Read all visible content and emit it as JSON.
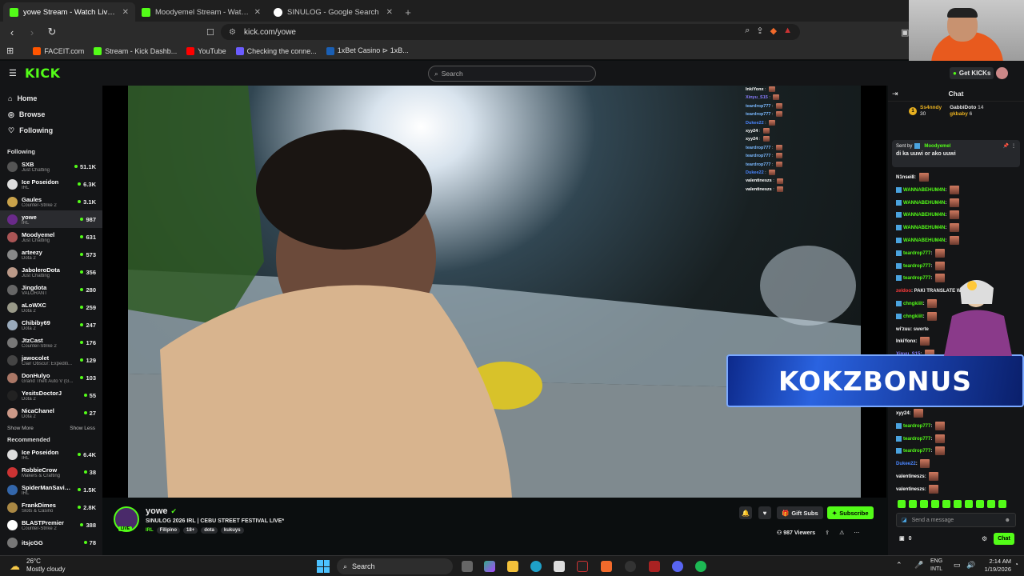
{
  "browser": {
    "tabs": [
      {
        "title": "yowe Stream - Watch Live on Kick",
        "icon": "K",
        "active": true
      },
      {
        "title": "Moodyemel Stream - Watch Live on Kick",
        "icon": "K",
        "active": false
      },
      {
        "title": "SINULOG - Google Search",
        "icon": "G",
        "active": false
      }
    ],
    "url": "kick.com/yowe",
    "bookmarks": [
      "FACEIT.com",
      "Stream - Kick Dashb...",
      "YouTube",
      "Checking the conne...",
      "1xBet Casino ⊳ 1xB..."
    ]
  },
  "kick": {
    "logo": "KICK",
    "search_placeholder": "Search",
    "get_kicks": "Get KICKs",
    "nav": [
      "Home",
      "Browse",
      "Following"
    ],
    "following_title": "Following",
    "recommended_title": "Recommended",
    "show_more": "Show More",
    "show_less": "Show Less",
    "following": [
      {
        "name": "SXB",
        "game": "Just Chatting",
        "viewers": "51.1K",
        "color": "#555"
      },
      {
        "name": "Ice Poseidon",
        "game": "IRL",
        "viewers": "6.3K",
        "color": "#ddd"
      },
      {
        "name": "Gaules",
        "game": "Counter-Strike 2",
        "viewers": "3.1K",
        "color": "#c9a24a"
      },
      {
        "name": "yowe",
        "game": "IRL",
        "viewers": "987",
        "color": "#6a2a8a"
      },
      {
        "name": "Moodyemel",
        "game": "Just Chatting",
        "viewers": "631",
        "color": "#a55"
      },
      {
        "name": "arteezy",
        "game": "Dota 2",
        "viewers": "573",
        "color": "#888"
      },
      {
        "name": "JaboleroDota",
        "game": "Just Chatting",
        "viewers": "356",
        "color": "#b98"
      },
      {
        "name": "Jingdota",
        "game": "VALORANT",
        "viewers": "280",
        "color": "#666"
      },
      {
        "name": "aLoWXC",
        "game": "Dota 2",
        "viewers": "259",
        "color": "#998"
      },
      {
        "name": "Chibiby69",
        "game": "Dota 2",
        "viewers": "247",
        "color": "#9ab"
      },
      {
        "name": "JtzCast",
        "game": "Counter-Strike 2",
        "viewers": "176",
        "color": "#777"
      },
      {
        "name": "jawocolet",
        "game": "Clair Obscur: Expediti...",
        "viewers": "129",
        "color": "#444"
      },
      {
        "name": "DonHulyo",
        "game": "Grand Theft Auto V (G...",
        "viewers": "103",
        "color": "#a76"
      },
      {
        "name": "YesitsDoctorJ",
        "game": "Dota 2",
        "viewers": "55",
        "color": "#222"
      },
      {
        "name": "NicaChanel",
        "game": "Dota 2",
        "viewers": "27",
        "color": "#c98"
      }
    ],
    "recommended": [
      {
        "name": "Ice Poseidon",
        "game": "IRL",
        "viewers": "6.4K",
        "color": "#ddd"
      },
      {
        "name": "RobbieCrow",
        "game": "Makers & Crafting",
        "viewers": "38",
        "color": "#c33"
      },
      {
        "name": "SpiderManSaving...",
        "game": "IRL",
        "viewers": "1.5K",
        "color": "#36a"
      },
      {
        "name": "FrankDimes",
        "game": "Slots & Casino",
        "viewers": "2.8K",
        "color": "#a84"
      },
      {
        "name": "BLASTPremier",
        "game": "Counter-Strike 2",
        "viewers": "388",
        "color": "#fff"
      },
      {
        "name": "itsjcGG",
        "game": "",
        "viewers": "78",
        "color": "#777"
      }
    ],
    "stream": {
      "channel": "yowe",
      "title": "SINULOG 2026 IRL | CEBU STREET FESTIVAL LIVE*",
      "category": "IRL",
      "tags": [
        "Filipino",
        "18+",
        "dota",
        "kukuys"
      ],
      "live_label": "LIVE",
      "viewers": "987 Viewers",
      "gift_subs": "Gift Subs",
      "subscribe": "Subscribe"
    },
    "overlay_chat": [
      {
        "user": "InkiYonx",
        "color": "#fff"
      },
      {
        "user": "Xinyu_S15",
        "color": "#8a7dff"
      },
      {
        "user": "teardrop777",
        "color": "#7ab8ff"
      },
      {
        "user": "teardrop777",
        "color": "#7ab8ff"
      },
      {
        "user": "Dukee22",
        "color": "#4a86ff"
      },
      {
        "user": "xyy24",
        "color": "#fff"
      },
      {
        "user": "xyy24",
        "color": "#fff"
      },
      {
        "user": "teardrop777",
        "color": "#7ab8ff"
      },
      {
        "user": "teardrop777",
        "color": "#7ab8ff"
      },
      {
        "user": "teardrop777",
        "color": "#7ab8ff"
      },
      {
        "user": "Dukee22",
        "color": "#4a86ff"
      },
      {
        "user": "valentineszs",
        "color": "#fff"
      },
      {
        "user": "valentineszs",
        "color": "#fff"
      }
    ],
    "chat": {
      "title": "Chat",
      "leaderboard": [
        {
          "rank": "1",
          "name": "Ss4nndy",
          "count": "30"
        },
        {
          "name": "GabbiDoto",
          "count": "14"
        },
        {
          "name": "gkbaby",
          "count": "6"
        }
      ],
      "pinned_sender_label": "Sent by",
      "pinned_sender": "Moodyemel",
      "pinned_text": "di ka uuwi or ako uuwi",
      "messages": [
        {
          "user": "N1nsei8",
          "text": "",
          "color": "#fff"
        },
        {
          "user": "WANNABEHUM4N",
          "text": "",
          "color": "#53fc18"
        },
        {
          "user": "WANNABEHUM4N",
          "text": "",
          "color": "#53fc18"
        },
        {
          "user": "WANNABEHUM4N",
          "text": "",
          "color": "#53fc18"
        },
        {
          "user": "WANNABEHUM4N",
          "text": "",
          "color": "#53fc18"
        },
        {
          "user": "WANNABEHUM4N",
          "text": "",
          "color": "#53fc18"
        },
        {
          "user": "teardrop777",
          "text": "",
          "color": "#53fc18"
        },
        {
          "user": "teardrop777",
          "text": "",
          "color": "#53fc18"
        },
        {
          "user": "teardrop777",
          "text": "",
          "color": "#53fc18"
        },
        {
          "user": "zeldoo",
          "text": "PAKI TRANSLATE WEEE",
          "color": "#ff3b3b"
        },
        {
          "user": "chngkiiit",
          "text": "",
          "color": "#53fc18"
        },
        {
          "user": "chngkiiit",
          "text": "",
          "color": "#53fc18"
        },
        {
          "user": "wi'zuu",
          "text": "swerte",
          "color": "#fff"
        },
        {
          "user": "InkiYonx",
          "text": "",
          "color": "#fff"
        },
        {
          "user": "Xinyu_S15",
          "text": "",
          "color": "#8a7dff"
        }
      ],
      "messages_bottom": [
        {
          "user": "xyy24",
          "text": "",
          "color": "#fff"
        },
        {
          "user": "teardrop777",
          "text": "",
          "color": "#53fc18"
        },
        {
          "user": "teardrop777",
          "text": "",
          "color": "#53fc18"
        },
        {
          "user": "teardrop777",
          "text": "",
          "color": "#53fc18"
        },
        {
          "user": "Dukee22",
          "text": "",
          "color": "#4a86ff"
        },
        {
          "user": "valentineszs",
          "text": "",
          "color": "#fff"
        },
        {
          "user": "valentineszs",
          "text": "",
          "color": "#fff"
        }
      ],
      "banner_text": "KOKZBONUS",
      "send_placeholder": "Send a message",
      "kicks_count": "0",
      "chat_button": "Chat"
    }
  },
  "taskbar": {
    "weather_temp": "26°C",
    "weather_text": "Mostly cloudy",
    "search": "Search",
    "lang1": "ENG",
    "lang2": "INTL",
    "time": "2:14 AM",
    "date": "1/19/2026"
  },
  "colors": {
    "kick_green": "#53fc18",
    "bg": "#0b0e0f"
  }
}
